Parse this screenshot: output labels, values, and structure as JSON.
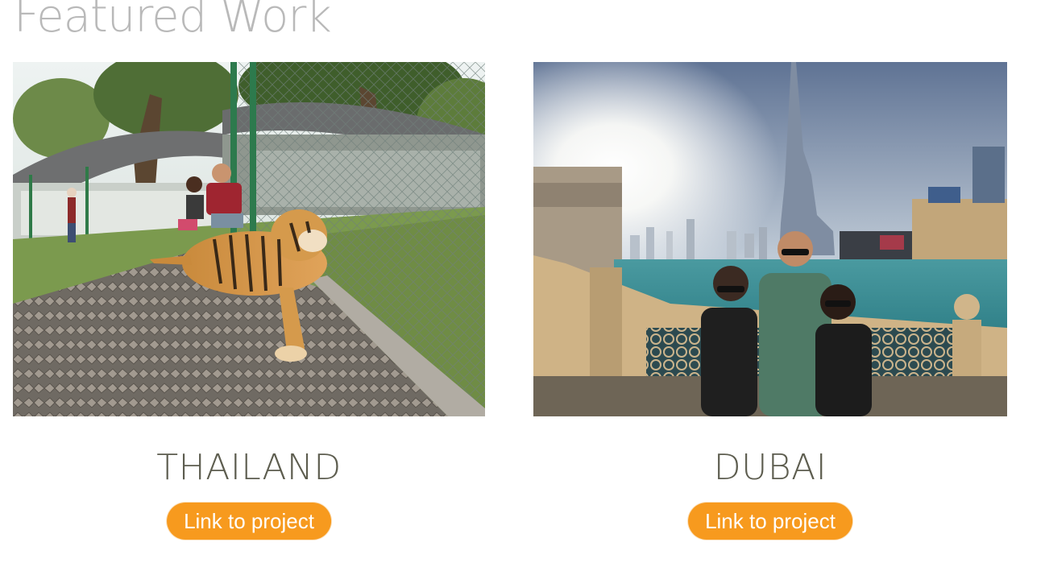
{
  "section": {
    "title": "Featured Work"
  },
  "projects": [
    {
      "name": "THAILAND",
      "link_label": "Link to project",
      "image_icon": "tiger-photo"
    },
    {
      "name": "DUBAI",
      "link_label": "Link to project",
      "image_icon": "dubai-skyline-photo"
    }
  ],
  "colors": {
    "accent": "#f79a1e",
    "title_gray": "#b9b9b9",
    "project_title": "#5d5d4f"
  }
}
